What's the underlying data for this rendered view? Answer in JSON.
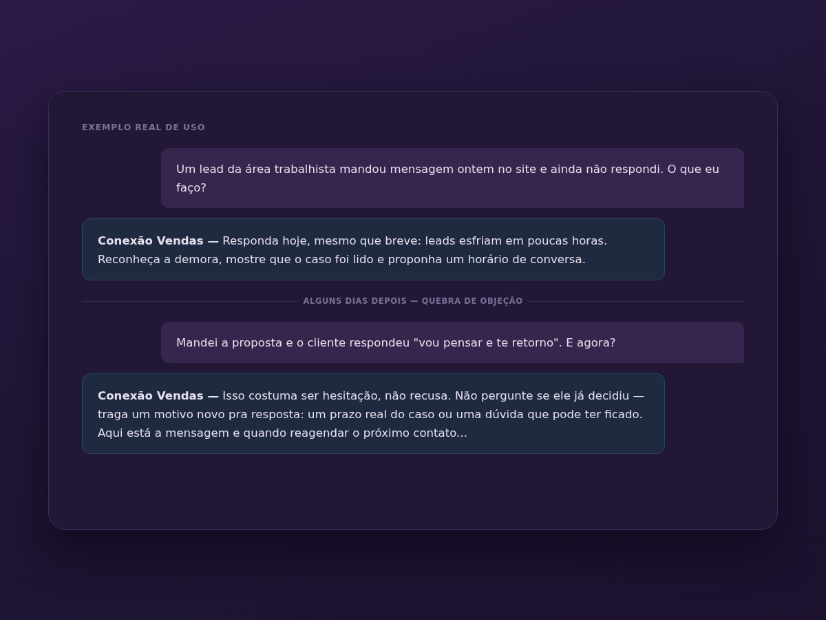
{
  "card": {
    "eyebrow": "EXEMPLO REAL DE USO",
    "messages": [
      {
        "kind": "user",
        "text": "Um lead da área trabalhista mandou mensagem ontem no site e ainda não respondi. O que eu faço?"
      },
      {
        "kind": "assistant",
        "text": "**Conexão Vendas —** Responda hoje, mesmo que breve: leads esfriam em poucas horas. Reconheça a demora, mostre que o caso foi lido e proponha um horário de conversa."
      },
      {
        "kind": "divider",
        "text": "ALGUNS DIAS DEPOIS — QUEBRA DE OBJEÇÃO"
      },
      {
        "kind": "user",
        "text": "Mandei a proposta e o cliente respondeu \"vou pensar e te retorno\". E agora?"
      },
      {
        "kind": "assistant",
        "text": "**Conexão Vendas —** Isso costuma ser hesitação, não recusa. Não pergunte se ele já decidiu — traga um motivo novo pra resposta: um prazo real do caso ou uma dúvida que pode ter ficado. Aqui está a mensagem e quando reagendar o próximo contato..."
      }
    ]
  }
}
